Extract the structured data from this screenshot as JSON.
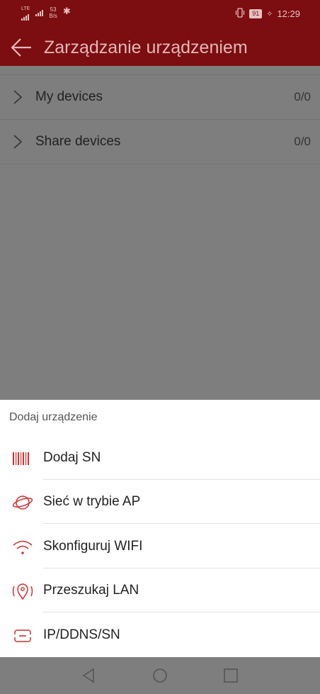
{
  "status_bar": {
    "network": "LTE",
    "speed_value": "53",
    "speed_unit": "B/s",
    "battery": "91",
    "time": "12:29"
  },
  "app_bar": {
    "title": "Zarządzanie urządzeniem",
    "back_icon": "arrow-left-icon"
  },
  "device_list": [
    {
      "label": "My devices",
      "count": "0/0",
      "icon": "chevron-right-icon"
    },
    {
      "label": "Share devices",
      "count": "0/0",
      "icon": "chevron-right-icon"
    }
  ],
  "add_sheet": {
    "title": "Dodaj urządzenie",
    "accent_color": "#d32f2f",
    "options": [
      {
        "label": "Dodaj SN",
        "icon": "barcode-icon"
      },
      {
        "label": "Sieć w trybie AP",
        "icon": "planet-icon"
      },
      {
        "label": "Skonfiguruj WIFI",
        "icon": "wifi-icon"
      },
      {
        "label": "Przeszukaj LAN",
        "icon": "location-pin-icon"
      },
      {
        "label": "IP/DDNS/SN",
        "icon": "ip-box-icon"
      }
    ]
  },
  "nav_bar": [
    "back-triangle-icon",
    "home-circle-icon",
    "recents-square-icon"
  ]
}
